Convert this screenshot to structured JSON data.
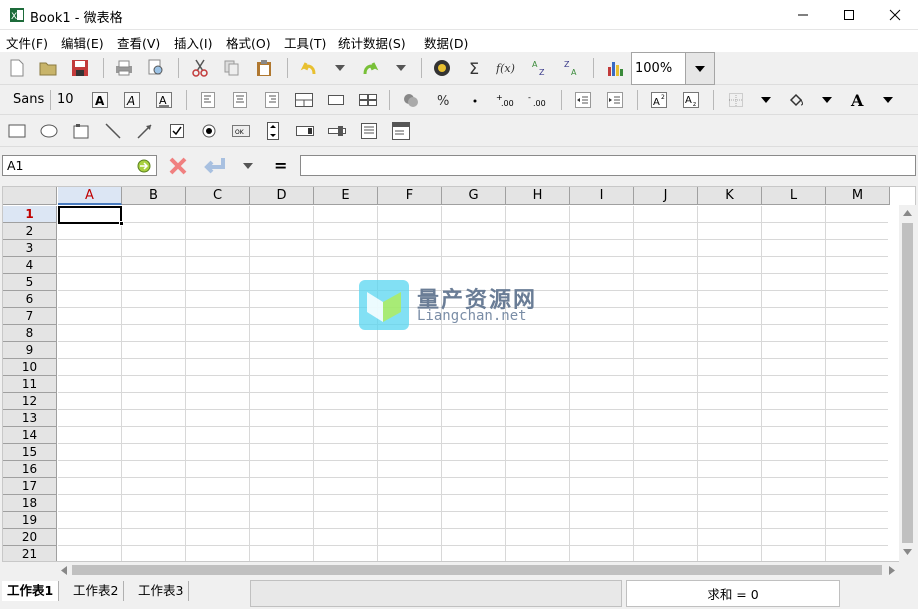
{
  "window": {
    "title": "Book1 - 微表格"
  },
  "menu": [
    "文件(F)",
    "编辑(E)",
    "查看(V)",
    "插入(I)",
    "格式(O)",
    "工具(T)",
    "统计数据(S)",
    "数据(D)"
  ],
  "zoom": {
    "value": "100%"
  },
  "font": {
    "name": "Sans",
    "size": "10"
  },
  "namebox": {
    "value": "A1"
  },
  "formula_equals": "=",
  "columns": [
    "A",
    "B",
    "C",
    "D",
    "E",
    "F",
    "G",
    "H",
    "I",
    "J",
    "K",
    "L",
    "M"
  ],
  "rows": [
    "1",
    "2",
    "3",
    "4",
    "5",
    "6",
    "7",
    "8",
    "9",
    "10",
    "11",
    "12",
    "13",
    "14",
    "15",
    "16",
    "17",
    "18",
    "19",
    "20",
    "21"
  ],
  "active_cell": "A1",
  "sheets": [
    "工作表1",
    "工作表2",
    "工作表3"
  ],
  "status": {
    "sum": "求和 = 0"
  },
  "watermark": {
    "title": "量产资源网",
    "subtitle": "Liangchan.net"
  }
}
